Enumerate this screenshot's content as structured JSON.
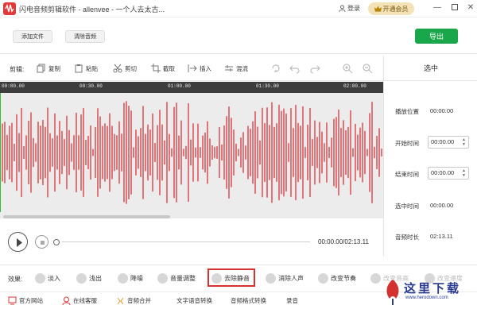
{
  "window": {
    "title": "闪电音频剪辑软件 - allenvee - 一个人去太古...",
    "login_label": "登录",
    "vip_label": "开通会员",
    "minimize_symbol": "—",
    "close_symbol": "✕"
  },
  "top_toolbar": {
    "add_file_label": "添加文件",
    "clear_audio_label": "清除音频",
    "export_label": "导出"
  },
  "edit_toolbar": {
    "label": "剪辑:",
    "tools": [
      {
        "label": "复制",
        "icon": "copy-icon"
      },
      {
        "label": "粘贴",
        "icon": "paste-icon"
      },
      {
        "label": "剪切",
        "icon": "scissors-icon"
      },
      {
        "label": "截取",
        "icon": "crop-icon"
      },
      {
        "label": "插入",
        "icon": "insert-icon"
      },
      {
        "label": "混流",
        "icon": "mix-icon"
      }
    ],
    "icon_tools": [
      "loop-icon",
      "undo-icon",
      "redo-icon",
      "zoom-in-icon",
      "zoom-out-icon"
    ]
  },
  "timeline": {
    "ticks": [
      "00:00.00",
      "00:30.00",
      "01:00.00",
      "01:30.00",
      "02:00.00"
    ],
    "wave_color": "#d9262b",
    "total_duration": "02:13.11"
  },
  "player": {
    "time_display": "00:00.00/02:13.11"
  },
  "sidebar": {
    "title": "选中",
    "play_position_label": "播放位置",
    "play_position_value": "00:00.00",
    "start_time_label": "开始时间",
    "start_time_value": "00:00.00",
    "end_time_label": "结束时间",
    "end_time_value": "00:00.00",
    "selection_length_label": "选中时间",
    "selection_length_value": "00:00.00",
    "audio_length_label": "音频时长",
    "audio_length_value": "02:13.11"
  },
  "effects": {
    "label": "效果:",
    "items": [
      {
        "label": "淡入",
        "icon": "fade-in-icon"
      },
      {
        "label": "浅出",
        "icon": "fade-out-icon"
      },
      {
        "label": "降噪",
        "icon": "denoise-icon"
      },
      {
        "label": "音量调整",
        "icon": "volume-icon"
      },
      {
        "label": "去除静音",
        "icon": "mute-remove-icon"
      },
      {
        "label": "消除人声",
        "icon": "vocal-remove-icon"
      },
      {
        "label": "改变节奏",
        "icon": "tempo-icon"
      },
      {
        "label": "改变音高",
        "icon": "pitch-icon"
      },
      {
        "label": "改变速度",
        "icon": "speed-icon"
      }
    ]
  },
  "bottom_links": {
    "official_site": "官方网站",
    "online_service": "在线客服",
    "audio_merge": "音频合并",
    "tts": "文字语音转换",
    "format_convert": "音频格式转换",
    "record": "录音"
  },
  "watermark": {
    "text": "这里下载",
    "url": "www.herodown.com"
  }
}
